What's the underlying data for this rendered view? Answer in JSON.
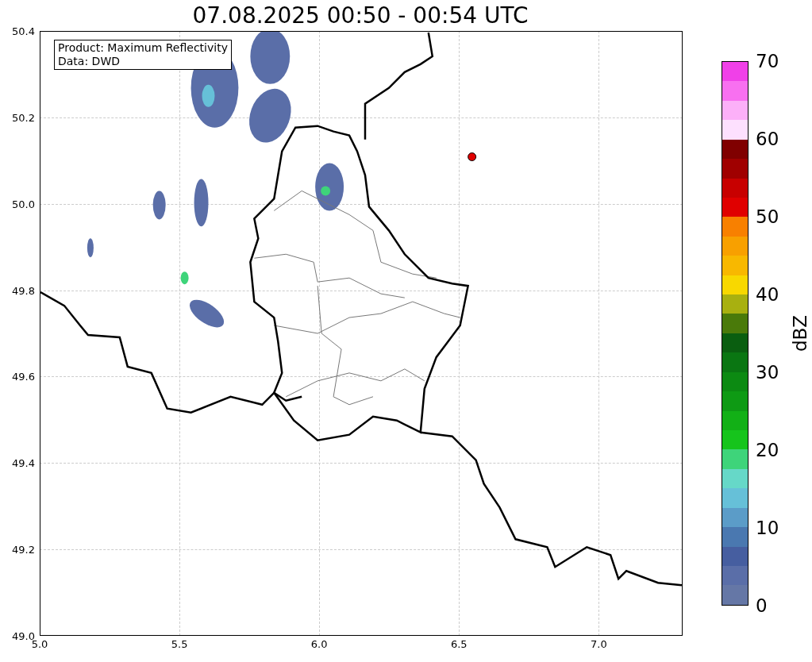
{
  "title": "07.08.2025 00:50 - 00:54 UTC",
  "legend_box": [
    "Product: Maximum Reflectivity",
    "Data: DWD"
  ],
  "x_ticks": [
    "5.0",
    "5.5",
    "6.0",
    "6.5",
    "7.0"
  ],
  "y_ticks": [
    "50.4",
    "50.2",
    "50.0",
    "49.8",
    "49.6",
    "49.4",
    "49.2",
    "49.0"
  ],
  "colorbar": {
    "label": "dBZ",
    "ticks": [
      "70",
      "60",
      "50",
      "40",
      "30",
      "20",
      "10",
      "0"
    ],
    "bands": [
      {
        "color": "#f040e8"
      },
      {
        "color": "#f870f0"
      },
      {
        "color": "#fcb0f8"
      },
      {
        "color": "#fde0fe"
      },
      {
        "color": "#800000"
      },
      {
        "color": "#a00000"
      },
      {
        "color": "#c80000"
      },
      {
        "color": "#e00000"
      },
      {
        "color": "#f88000"
      },
      {
        "color": "#f8a000"
      },
      {
        "color": "#f8b800"
      },
      {
        "color": "#f8d800"
      },
      {
        "color": "#a8b010"
      },
      {
        "color": "#4a7a0a"
      },
      {
        "color": "#0a5e10"
      },
      {
        "color": "#0a7612"
      },
      {
        "color": "#0c8a12"
      },
      {
        "color": "#0e9a14"
      },
      {
        "color": "#12b016"
      },
      {
        "color": "#16c41c"
      },
      {
        "color": "#3ed47a"
      },
      {
        "color": "#66d8c8"
      },
      {
        "color": "#66c0d8"
      },
      {
        "color": "#5b9cc8"
      },
      {
        "color": "#4a78b0"
      },
      {
        "color": "#465ea0"
      },
      {
        "color": "#5a6ea8"
      },
      {
        "color": "#6577a6"
      }
    ]
  }
}
